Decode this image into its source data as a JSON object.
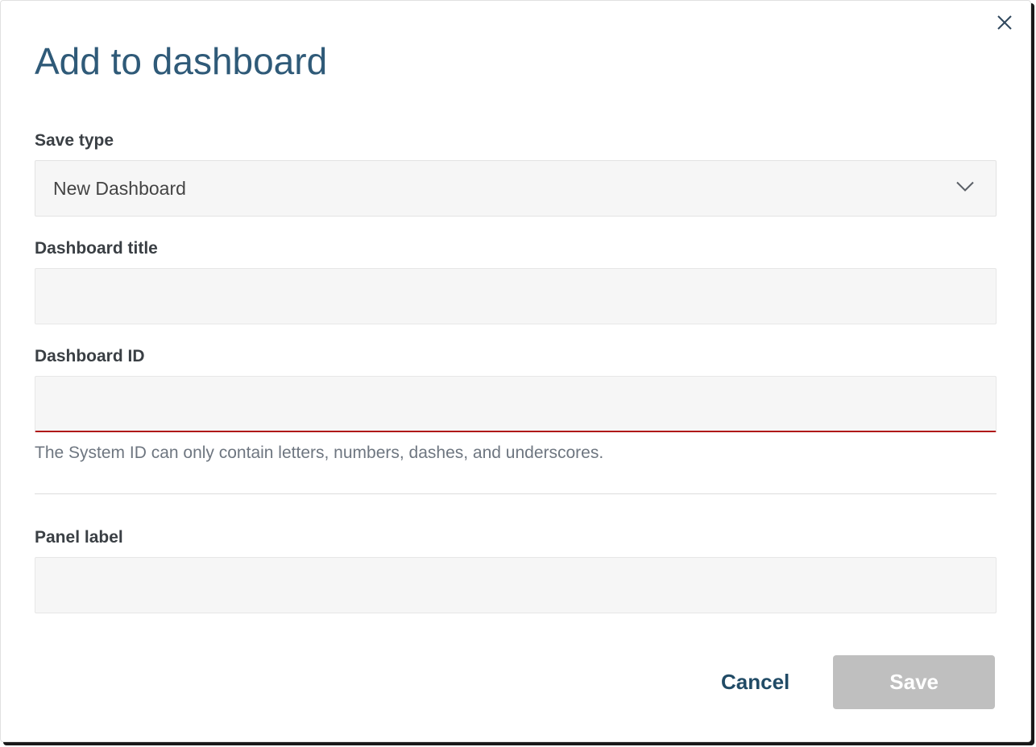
{
  "modal": {
    "title": "Add to dashboard",
    "fields": {
      "save_type": {
        "label": "Save type",
        "value": "New Dashboard"
      },
      "dashboard_title": {
        "label": "Dashboard title",
        "value": ""
      },
      "dashboard_id": {
        "label": "Dashboard ID",
        "value": "",
        "help": "The System ID can only contain letters, numbers, dashes, and underscores."
      },
      "panel_label": {
        "label": "Panel label",
        "value": ""
      }
    },
    "buttons": {
      "cancel": "Cancel",
      "save": "Save"
    }
  }
}
